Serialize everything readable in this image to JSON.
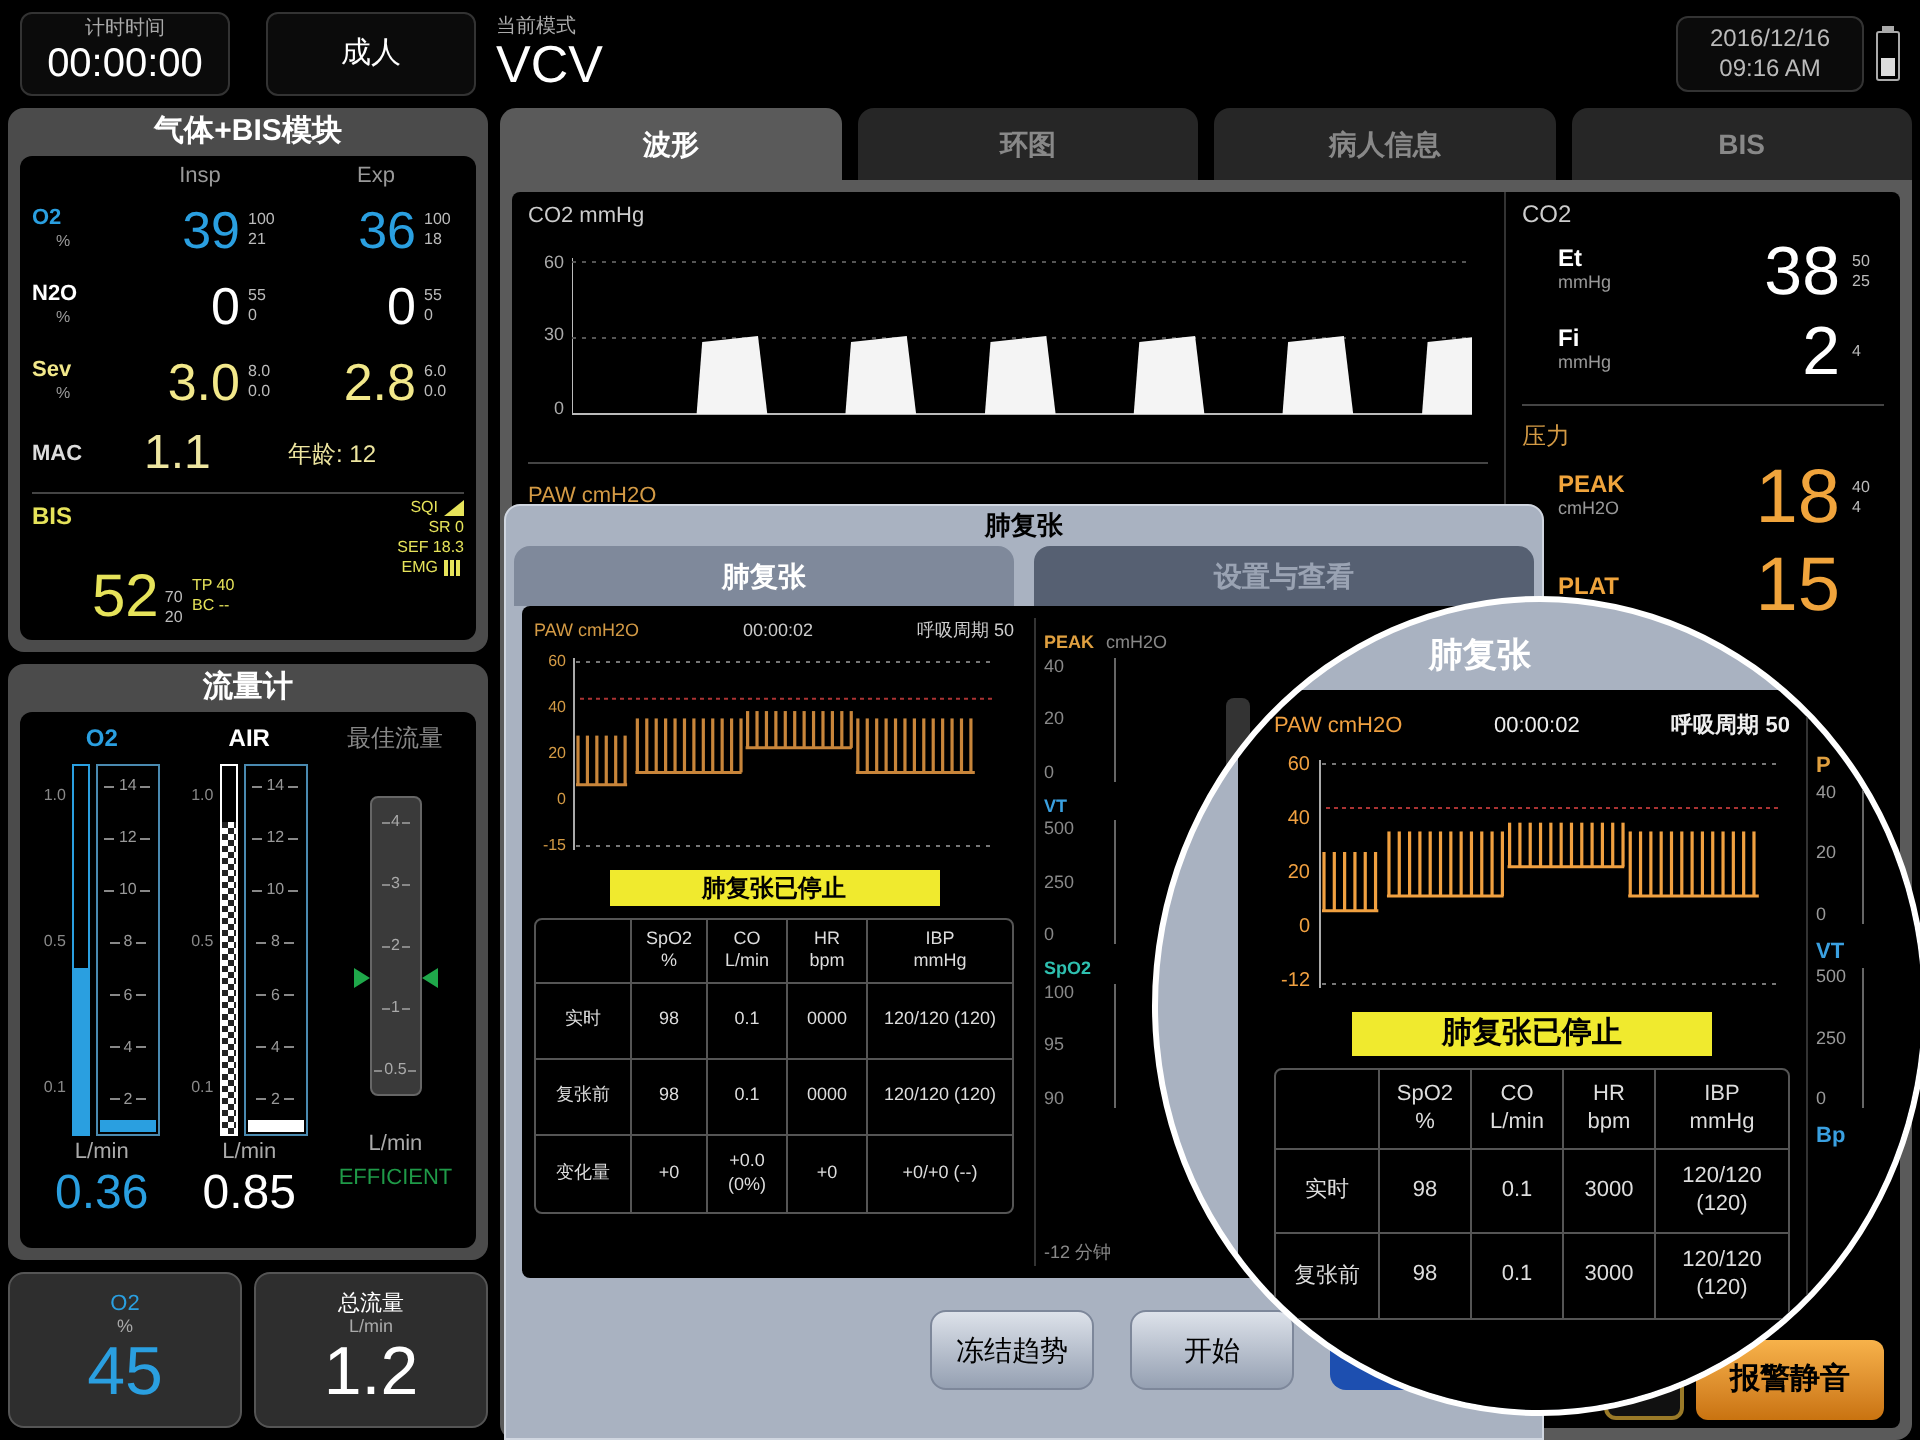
{
  "top_bar": {
    "timer": {
      "label": "计时时间",
      "value": "00:00:00"
    },
    "patient_type": "成人",
    "mode": {
      "label": "当前模式",
      "value": "VCV"
    },
    "datetime": {
      "date": "2016/12/16",
      "time": "09:16 AM"
    }
  },
  "gas_module": {
    "title": "气体+BIS模块",
    "columns": [
      "Insp",
      "Exp"
    ],
    "rows": [
      {
        "name": "O2",
        "unit": "%",
        "color": "#2a9fe0",
        "insp": "39",
        "insp_limits": [
          "100",
          "21"
        ],
        "exp": "36",
        "exp_limits": [
          "100",
          "18"
        ]
      },
      {
        "name": "N2O",
        "unit": "%",
        "color": "#ffffff",
        "insp": "0",
        "insp_limits": [
          "55",
          "0"
        ],
        "exp": "0",
        "exp_limits": [
          "55",
          "0"
        ]
      },
      {
        "name": "Sev",
        "unit": "%",
        "color": "#f2e88a",
        "insp": "3.0",
        "insp_limits": [
          "8.0",
          "0.0"
        ],
        "exp": "2.8",
        "exp_limits": [
          "6.0",
          "0.0"
        ]
      }
    ],
    "mac": {
      "label": "MAC",
      "value": "1.1",
      "age": "年龄: 12"
    },
    "bis": {
      "label": "BIS",
      "value": "52",
      "limits": [
        "70",
        "20"
      ],
      "middle": [
        "TP 40",
        "BC --"
      ],
      "right": [
        {
          "text": "SQI",
          "kind": "signal"
        },
        {
          "text": "SR 0",
          "kind": "text"
        },
        {
          "text": "SEF 18.3",
          "kind": "text"
        },
        {
          "text": "EMG",
          "kind": "bars"
        }
      ]
    }
  },
  "flowmeter": {
    "title": "流量计",
    "gases": [
      {
        "name": "O2",
        "color": "#2a9fe0",
        "kind": "solid",
        "level": 0.45,
        "scale": [
          "1.0",
          "0.5",
          "0.1"
        ],
        "tube_scale": [
          "14",
          "12",
          "10",
          "8",
          "6",
          "4",
          "2"
        ],
        "unit": "L/min",
        "value": "0.36"
      },
      {
        "name": "AIR",
        "color": "#ffffff",
        "kind": "checker",
        "level": 0.85,
        "scale": [
          "1.0",
          "0.5",
          "0.1"
        ],
        "tube_scale": [
          "14",
          "12",
          "10",
          "8",
          "6",
          "4",
          "2"
        ],
        "unit": "L/min",
        "value": "0.85"
      }
    ],
    "optimal": {
      "label": "最佳流量",
      "scale": [
        "4",
        "3",
        "2",
        "1",
        "0.5"
      ],
      "unit": "L/min",
      "status": "EFFICIENT"
    }
  },
  "tiles": [
    {
      "label": "O2",
      "unit": "%",
      "value": "45",
      "color": "#2a9fe0"
    },
    {
      "label": "总流量",
      "unit": "L/min",
      "value": "1.2",
      "color": "#ffffff"
    }
  ],
  "tabs": [
    {
      "label": "波形",
      "selected": true
    },
    {
      "label": "环图",
      "selected": false
    },
    {
      "label": "病人信息",
      "selected": false
    },
    {
      "label": "BIS",
      "selected": false
    }
  ],
  "waves": {
    "co2_label": "CO2  mmHg",
    "co2_ticks": [
      "60",
      "30",
      "0"
    ],
    "paw_label": "PAW  cmH2O"
  },
  "numerics": {
    "co2": {
      "title": "CO2",
      "items": [
        {
          "name": "Et",
          "unit": "mmHg",
          "value": "38",
          "limits": [
            "50",
            "25"
          ]
        },
        {
          "name": "Fi",
          "unit": "mmHg",
          "value": "2",
          "limits": [
            "4"
          ]
        }
      ]
    },
    "pressure": {
      "title": "压力",
      "items": [
        {
          "name": "PEAK",
          "unit": "cmH2O",
          "value": "18",
          "limits": [
            "40",
            "4"
          ]
        },
        {
          "name": "PLAT",
          "value": "15"
        }
      ]
    }
  },
  "alarm_button": "报警静音",
  "dialog": {
    "title": "肺复张",
    "tabs": [
      {
        "label": "肺复张",
        "selected": true
      },
      {
        "label": "设置与查看",
        "selected": false
      }
    ],
    "chart": {
      "label": "PAW  cmH2O",
      "time": "00:00:02",
      "cycles": "呼吸周期 50",
      "ticks": [
        "60",
        "40",
        "20",
        "0",
        "-15"
      ]
    },
    "status": "肺复张已停止",
    "columns": [
      {
        "name": "SpO2",
        "unit": "%"
      },
      {
        "name": "CO",
        "unit": "L/min"
      },
      {
        "name": "HR",
        "unit": "bpm"
      },
      {
        "name": "IBP",
        "unit": "mmHg"
      }
    ],
    "rows": [
      {
        "label": "实时",
        "cells": [
          "98",
          "0.1",
          "0000",
          "120/120 (120)"
        ]
      },
      {
        "label": "复张前",
        "cells": [
          "98",
          "0.1",
          "0000",
          "120/120 (120)"
        ]
      },
      {
        "label": "变化量",
        "cells": [
          "+0",
          "+0.0 (0%)",
          "+0",
          "+0/+0 (--)"
        ]
      }
    ],
    "trends": [
      {
        "name": "PEAK",
        "unit": "cmH2O",
        "color": "#e0a040",
        "ticks": [
          "40",
          "20",
          "0"
        ]
      },
      {
        "name": "VT",
        "color": "#3aa0e0",
        "ticks": [
          "500",
          "250",
          "0"
        ]
      },
      {
        "name": "SpO2",
        "color": "#2ec0b0",
        "ticks": [
          "100",
          "95",
          "90"
        ]
      }
    ],
    "x_label": "-12 分钟",
    "buttons": [
      "冻结趋势",
      "开始"
    ]
  },
  "magnifier": {
    "title": "肺复张",
    "chart": {
      "label": "PAW  cmH2O",
      "time": "00:00:02",
      "cycles": "呼吸周期 50",
      "ticks": [
        "60",
        "40",
        "20",
        "0",
        "-12"
      ]
    },
    "status": "肺复张已停止",
    "columns": [
      {
        "name": "SpO2",
        "unit": "%"
      },
      {
        "name": "CO",
        "unit": "L/min"
      },
      {
        "name": "HR",
        "unit": "bpm"
      },
      {
        "name": "IBP",
        "unit": "mmHg"
      }
    ],
    "rows": [
      {
        "label": "实时",
        "cells": [
          "98",
          "0.1",
          "3000",
          "120/120 (120)"
        ]
      },
      {
        "label": "复张前",
        "cells": [
          "98",
          "0.1",
          "3000",
          "120/120 (120)"
        ]
      }
    ],
    "side": [
      {
        "name": "P",
        "color": "#e0a040",
        "ticks": [
          "40",
          "20",
          "0"
        ]
      },
      {
        "name": "VT",
        "color": "#3aa0e0",
        "ticks": [
          "500",
          "250",
          "0"
        ]
      },
      {
        "name": "Bp",
        "color": "#3aa0e0"
      }
    ]
  }
}
